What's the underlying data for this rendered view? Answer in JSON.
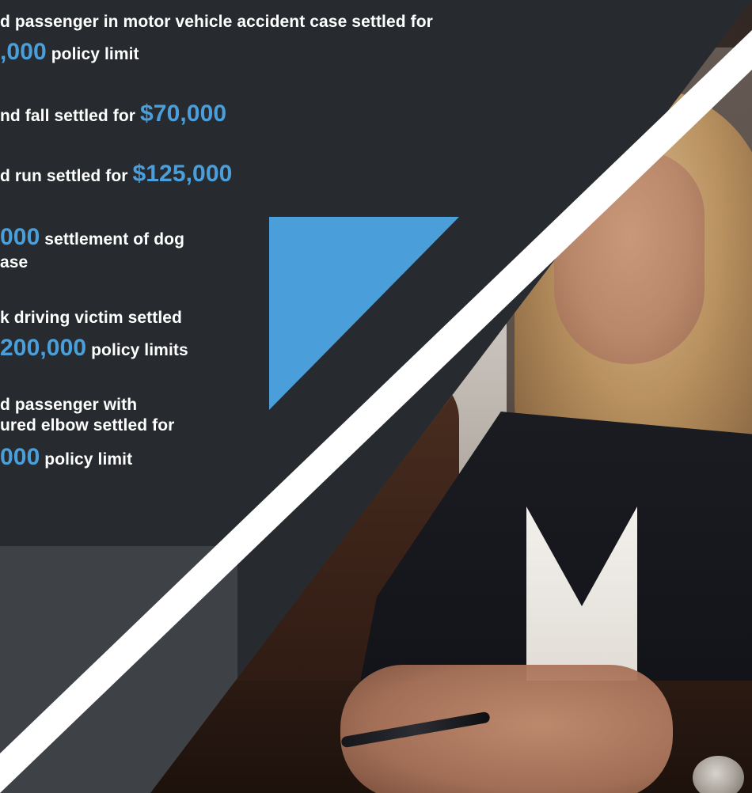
{
  "text_items": [
    {
      "line1": "d passenger in motor vehicle accident case settled for",
      "amount": ",000",
      "after": " policy limit"
    },
    {
      "before": "nd fall settled for ",
      "amount": "$70,000"
    },
    {
      "before": "d run settled for ",
      "amount": "$125,000"
    },
    {
      "amount": "000",
      "after": " settlement of dog",
      "line2": "ase"
    },
    {
      "line1": "k driving victim settled",
      "amount": "200,000",
      "after": " policy limits"
    },
    {
      "line1": "d passenger with",
      "line2": "ured elbow  settled for",
      "amount": "000",
      "after": " policy limit"
    }
  ],
  "colors": {
    "accent_blue": "#4a9fdb",
    "bg_dark": "#272b2f",
    "bg_grey_band": "#3e4246",
    "stripe": "#ffffff"
  }
}
